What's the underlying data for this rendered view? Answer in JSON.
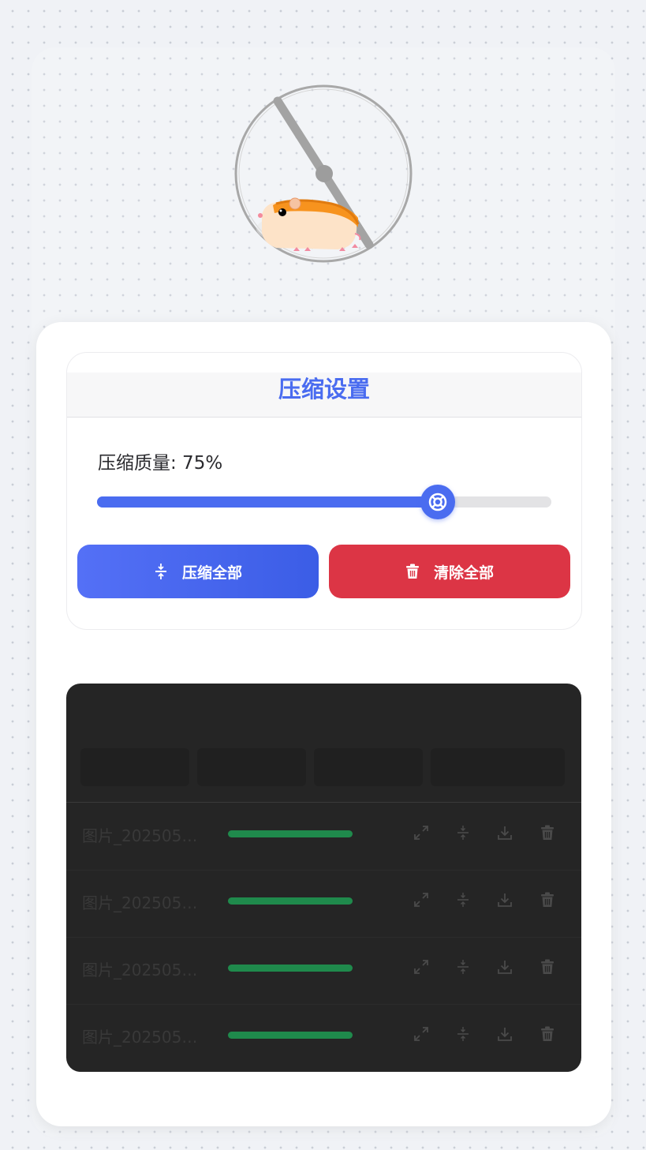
{
  "settings": {
    "title": "压缩设置",
    "quality_label": "压缩质量: 75%",
    "quality_value": 0.75,
    "compress_all_label": "压缩全部",
    "clear_all_label": "清除全部"
  },
  "colors": {
    "accent": "#4a6cf0",
    "danger": "#dc3545",
    "success": "#1f8a4c",
    "panel_dark": "#252525"
  },
  "file_list": {
    "rows": [
      {
        "name": "图片_2025050...",
        "progress": 1.0
      },
      {
        "name": "图片_2025050...",
        "progress": 1.0
      },
      {
        "name": "图片_2025050...",
        "progress": 1.0
      },
      {
        "name": "图片_2025050...",
        "progress": 1.0
      }
    ],
    "row_actions": [
      "expand-icon",
      "compress-icon",
      "download-icon",
      "trash-icon"
    ]
  }
}
